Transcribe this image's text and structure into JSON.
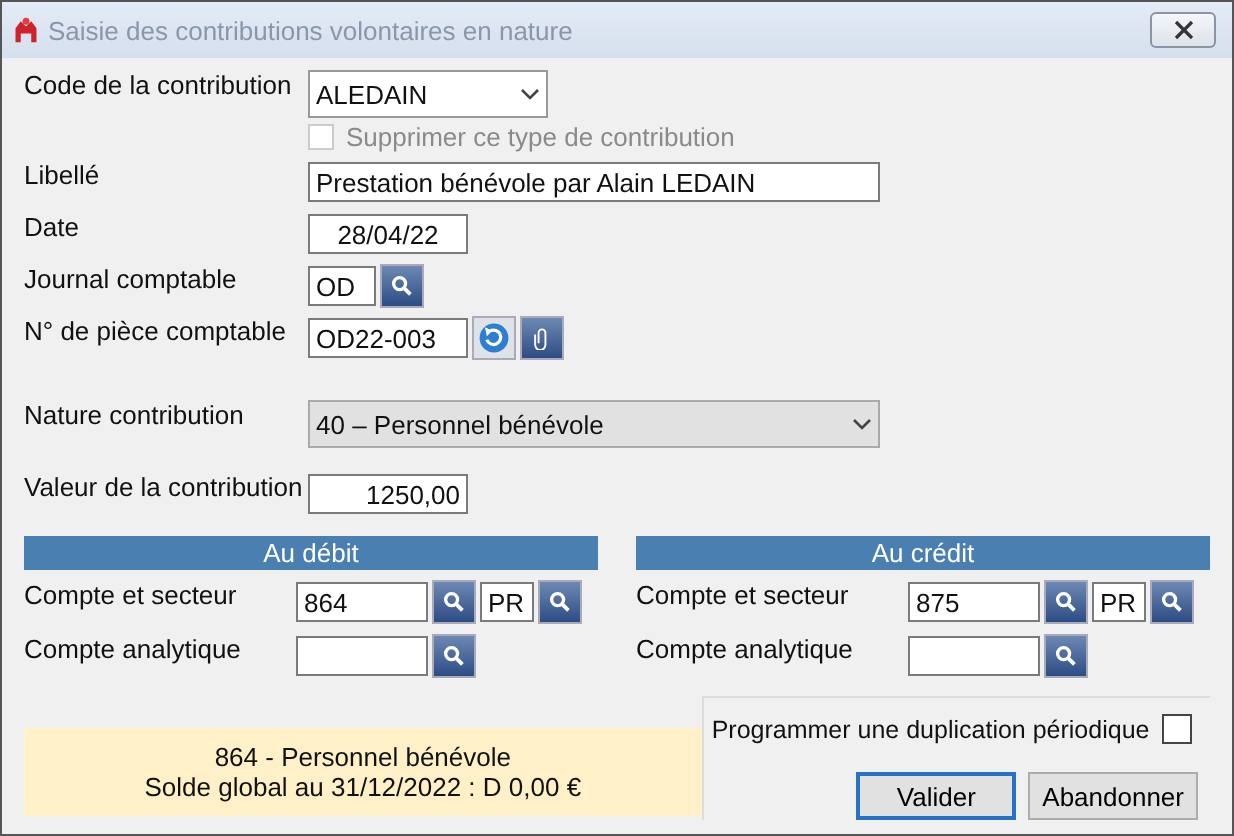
{
  "window": {
    "title": "Saisie des contributions volontaires en nature"
  },
  "code": {
    "label": "Code de la contribution",
    "value": "ALEDAIN"
  },
  "delete_type": {
    "label": "Supprimer ce type de contribution",
    "checked": false,
    "disabled": true
  },
  "libelle": {
    "label": "Libellé",
    "value": "Prestation bénévole par Alain LEDAIN"
  },
  "date": {
    "label": "Date",
    "value": "28/04/22"
  },
  "journal": {
    "label": "Journal comptable",
    "value": "OD"
  },
  "piece": {
    "label": "N° de pièce comptable",
    "value": "OD22-003"
  },
  "nature": {
    "label": "Nature contribution",
    "value": "40 – Personnel bénévole"
  },
  "valeur": {
    "label": "Valeur de la contribution",
    "value": "1250,00"
  },
  "sections": [
    {
      "header": "Au débit",
      "account": {
        "label": "Compte et secteur",
        "value": "864",
        "sector": "PR"
      },
      "analytic": {
        "label": "Compte analytique"
      }
    },
    {
      "header": "Au crédit",
      "account": {
        "label": "Compte et secteur",
        "value": "875",
        "sector": "PR"
      },
      "analytic": {
        "label": "Compte analytique"
      }
    }
  ],
  "info": [
    "864 - Personnel bénévole",
    "Solde global au 31/12/2022 : D 0,00 €"
  ],
  "duplication": {
    "label": "Programmer une duplication périodique",
    "checked": false
  },
  "buttons": [
    {
      "label": "Valider",
      "default": true
    },
    {
      "label": "Abandonner",
      "default": false
    }
  ]
}
